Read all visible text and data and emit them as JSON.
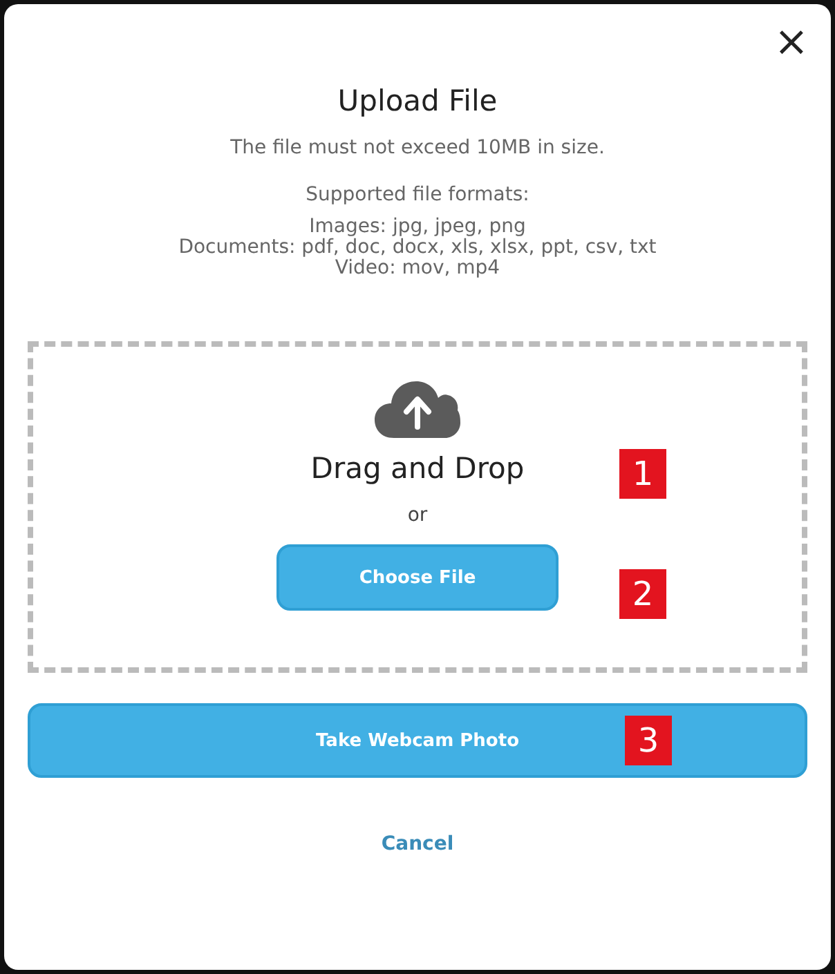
{
  "dialog": {
    "close": "×",
    "title": "Upload File",
    "size_note": "The file must not exceed 10MB in size.",
    "formats_heading": "Supported file formats:",
    "formats": [
      "Images: jpg, jpeg, png",
      "Documents: pdf, doc, docx, xls, xlsx, ppt, csv, txt",
      "Video: mov, mp4"
    ]
  },
  "drop_zone": {
    "heading": "Drag and Drop",
    "heading_marker": "1",
    "or": "or",
    "button": "Choose File",
    "button_marker": "2"
  },
  "webcam": {
    "button": "Take Webcam Photo",
    "marker": "3"
  },
  "cancel": "Cancel"
}
